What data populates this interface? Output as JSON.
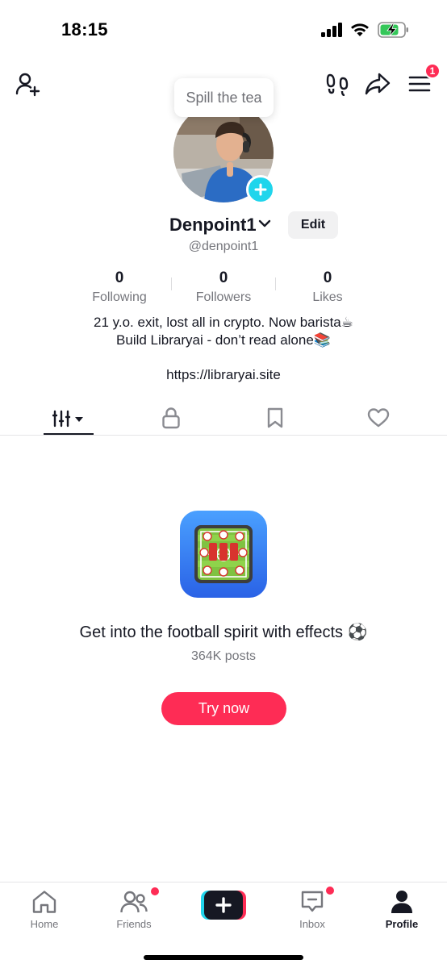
{
  "status_bar": {
    "time": "18:15"
  },
  "header": {
    "menu_badge": "1"
  },
  "tooltip": {
    "text": "Spill the tea"
  },
  "profile": {
    "display_name": "Denpoint1",
    "edit_label": "Edit",
    "username": "@denpoint1",
    "stats": [
      {
        "value": "0",
        "label": "Following"
      },
      {
        "value": "0",
        "label": "Followers"
      },
      {
        "value": "0",
        "label": "Likes"
      }
    ],
    "bio_line1": "21 y.o. exit, lost all in crypto. Now barista☕",
    "bio_line2": "Build Libraryai - don’t read alone📚",
    "link": "https://libraryai.site"
  },
  "tabs": [
    {
      "icon": "videos-grid-icon",
      "active": true
    },
    {
      "icon": "lock-icon",
      "active": false
    },
    {
      "icon": "bookmark-icon",
      "active": false
    },
    {
      "icon": "heart-icon",
      "active": false
    }
  ],
  "effect": {
    "title": "Get into the football spirit with effects ⚽",
    "posts": "364K posts",
    "cta": "Try now"
  },
  "bottom_nav": [
    {
      "label": "Home",
      "icon": "home-icon",
      "active": false
    },
    {
      "label": "Friends",
      "icon": "friends-icon",
      "active": false
    },
    {
      "label": "",
      "icon": "create-plus-icon",
      "active": false
    },
    {
      "label": "Inbox",
      "icon": "inbox-icon",
      "active": false
    },
    {
      "label": "Profile",
      "icon": "profile-icon",
      "active": true
    }
  ],
  "colors": {
    "accent": "#fe2c55",
    "cyan": "#20d5ec",
    "text": "#161823",
    "muted": "#75767c"
  }
}
